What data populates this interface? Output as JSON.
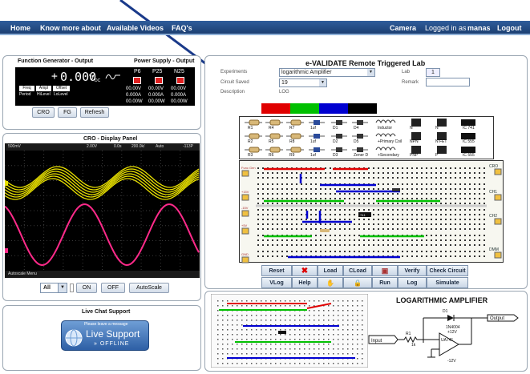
{
  "nav": {
    "home": "Home",
    "know_more": "Know more about",
    "videos": "Available Videos",
    "faq": "FAQ's",
    "camera": "Camera",
    "logged_in": "Logged in as",
    "username": "manas",
    "logout": "Logout"
  },
  "function_generator": {
    "title": "Function Generator - Output",
    "display_sign": "+",
    "display_value": "0.000",
    "unit": "V",
    "unit_sub": "DC",
    "mode_buttons": [
      "Freq",
      "Ampl",
      "Offset"
    ],
    "mode_values": [
      "Period",
      "HiLevel",
      "LoLevel"
    ]
  },
  "power_supply": {
    "title": "Power Supply - Output",
    "channels": [
      {
        "name": "P6",
        "voltage": "00.00V",
        "current": "0.000A",
        "power": "00.00W"
      },
      {
        "name": "P25",
        "voltage": "00.00V",
        "current": "0.000A",
        "power": "00.00W"
      },
      {
        "name": "N25",
        "voltage": "00.00V",
        "current": "0.000A",
        "power": "00.00W"
      }
    ]
  },
  "instrument_buttons": {
    "cro": "CRO",
    "fg": "FG",
    "refresh": "Refresh"
  },
  "cro": {
    "title": "CRO - Display Panel",
    "status": [
      "500mV",
      "2.00V",
      "0.0s",
      "200.0k/",
      "Auto",
      "-113P"
    ],
    "menu_label": "Autoscale Menu",
    "channel_select": "All",
    "on": "ON",
    "off": "OFF",
    "autoscale": "AutoScale",
    "colors": {
      "ch1": "#e8e000",
      "ch2": "#ff2a8a",
      "screen": "#000000",
      "grid": "#3a3a3a"
    }
  },
  "chat": {
    "title": "Live Chat Support",
    "leave_message": "Please leave a message",
    "live_support": "Live Support",
    "offline": "OFFLINE"
  },
  "lab": {
    "title": "e-VALIDATE Remote Triggered Lab",
    "experiments_label": "Experiments",
    "experiment_value": "logarithmic Amplifier",
    "circuit_saved_label": "Circuit Saved",
    "circuit_saved_value": "19",
    "description_label": "Description",
    "description_value": "LOG",
    "lab_label": "Lab",
    "lab_value": "1",
    "remark_label": "Remark",
    "remark_value": "",
    "wire_colors": [
      "#e00000",
      "#00c000",
      "#0000d0",
      "#000000"
    ],
    "components_row1": [
      "R1",
      "R4",
      "R7",
      "1uf",
      "D1",
      "D4",
      "Inductor",
      "N",
      "N",
      "IC 741"
    ],
    "components_row2": [
      "R2",
      "R5",
      "R8",
      "1uf",
      "D2",
      "D5",
      "+Primary Coil",
      "NPN",
      "N FET",
      "IC 555"
    ],
    "components_row3": [
      "R3",
      "R6",
      "R9",
      "1uf",
      "D3",
      "Zener D",
      "+Secondary",
      "PNP",
      "P",
      "IC 555"
    ],
    "pin_labels": [
      "B",
      "C",
      "E",
      "G",
      "D",
      "S"
    ],
    "rail_labels_left": [
      "Func Gen",
      "+15V",
      "-15V",
      "+5V",
      "GND"
    ],
    "rail_labels_right": [
      "CRO",
      "CH1",
      "CH2",
      "DMM"
    ],
    "ic_chip_label": "741"
  },
  "actions": {
    "row1": [
      "Reset",
      "",
      "Load",
      "CLoad",
      "",
      "Verify",
      "Check Circuit"
    ],
    "row2": [
      "VLog",
      "Help",
      "",
      "",
      "Run",
      "Log",
      "Simulate"
    ]
  },
  "schematic": {
    "title": "LOGARITHMIC AMPLIFIER",
    "diode_label": "D1",
    "diode_part": "1N4004",
    "output": "Output",
    "input": "Input",
    "resistor": "R1",
    "resistor_value": "1k",
    "opamp": "UA741",
    "vpos": "+12V",
    "vneg": "-12V"
  }
}
